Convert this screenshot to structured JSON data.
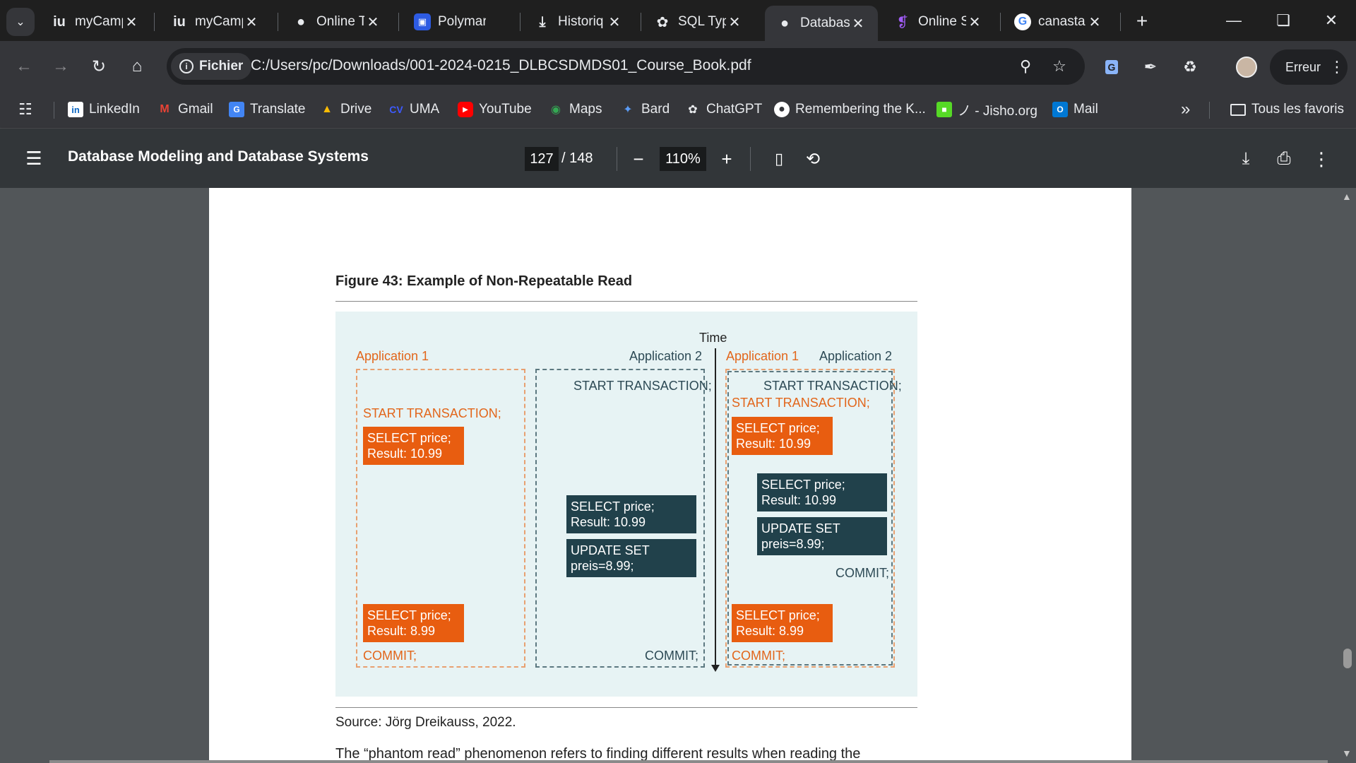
{
  "tabs": [
    {
      "favicon": "iu",
      "title": "myCamp",
      "active": false
    },
    {
      "favicon": "iu",
      "title": "myCamp",
      "active": false
    },
    {
      "favicon": "globe-icon",
      "title": "Online T",
      "active": false
    },
    {
      "favicon": "polymarket-icon",
      "title": "Polymar",
      "active": false
    },
    {
      "favicon": "download-icon",
      "title": "Historiq",
      "active": false
    },
    {
      "favicon": "openai-icon",
      "title": "SQL Typ",
      "active": false
    },
    {
      "favicon": "globe-icon",
      "title": "Databas",
      "active": true
    },
    {
      "favicon": "perplexity-icon",
      "title": "Online S",
      "active": false
    },
    {
      "favicon": "google-icon",
      "title": "canasta",
      "active": false
    }
  ],
  "omnibox": {
    "chip_label": "Fichier",
    "url": "C:/Users/pc/Downloads/001-2024-0215_DLBCSDMDS01_Course_Book.pdf"
  },
  "profile": {
    "error_label": "Erreur"
  },
  "bookmarks": [
    {
      "icon": "linkedin-icon",
      "label": "LinkedIn"
    },
    {
      "icon": "gmail-icon",
      "label": "Gmail"
    },
    {
      "icon": "translate-icon",
      "label": "Translate"
    },
    {
      "icon": "drive-icon",
      "label": "Drive"
    },
    {
      "icon": "uma-icon",
      "label": "UMA"
    },
    {
      "icon": "youtube-icon",
      "label": "YouTube"
    },
    {
      "icon": "maps-icon",
      "label": "Maps"
    },
    {
      "icon": "bard-icon",
      "label": "Bard"
    },
    {
      "icon": "chatgpt-icon",
      "label": "ChatGPT"
    },
    {
      "icon": "globe-icon",
      "label": "Remembering the K..."
    },
    {
      "icon": "jisho-icon",
      "label": "ノ - Jisho.org"
    },
    {
      "icon": "outlook-icon",
      "label": "Mail"
    }
  ],
  "bookmarks_more": "»",
  "all_bookmarks_label": "Tous les favoris",
  "pdf": {
    "doc_title": "Database Modeling and Database Systems",
    "current_page": "127",
    "total_pages": "/ 148",
    "zoom": "110%"
  },
  "page": {
    "figure_title": "Figure 43: Example of Non-Repeatable Read",
    "source": "Source: Jörg Dreikauss, 2022.",
    "body_text": "The “phantom read” phenomenon refers to finding different results when reading the"
  },
  "diagram": {
    "time_label": "Time",
    "left": {
      "app1_label": "Application 1",
      "app2_label": "Application 2",
      "app1_start": "START TRANSACTION;",
      "app1_select1": [
        "SELECT price;",
        "Result: 10.99"
      ],
      "app1_select2": [
        "SELECT price;",
        "Result: 8.99"
      ],
      "app1_commit": "COMMIT;",
      "app2_start": "START TRANSACTION;",
      "app2_select": [
        "SELECT price;",
        "Result: 10.99"
      ],
      "app2_update": [
        "UPDATE SET",
        "preis=8.99;"
      ],
      "app2_commit": "COMMIT;"
    },
    "right": {
      "app1_label": "Application 1",
      "app2_label": "Application 2",
      "app2_start": "START TRANSACTION;",
      "app1_start": "START TRANSACTION;",
      "app1_select1": [
        "SELECT price;",
        "Result: 10.99"
      ],
      "app2_select": [
        "SELECT price;",
        "Result: 10.99"
      ],
      "app2_update": [
        "UPDATE SET",
        "preis=8.99;"
      ],
      "app2_commit": "COMMIT;",
      "app1_select2": [
        "SELECT price;",
        "Result: 8.99"
      ],
      "app1_commit": "COMMIT;"
    }
  },
  "colors": {
    "orange": "#e85d10",
    "dark_teal": "#21414b",
    "figure_bg": "#e7f3f4"
  }
}
